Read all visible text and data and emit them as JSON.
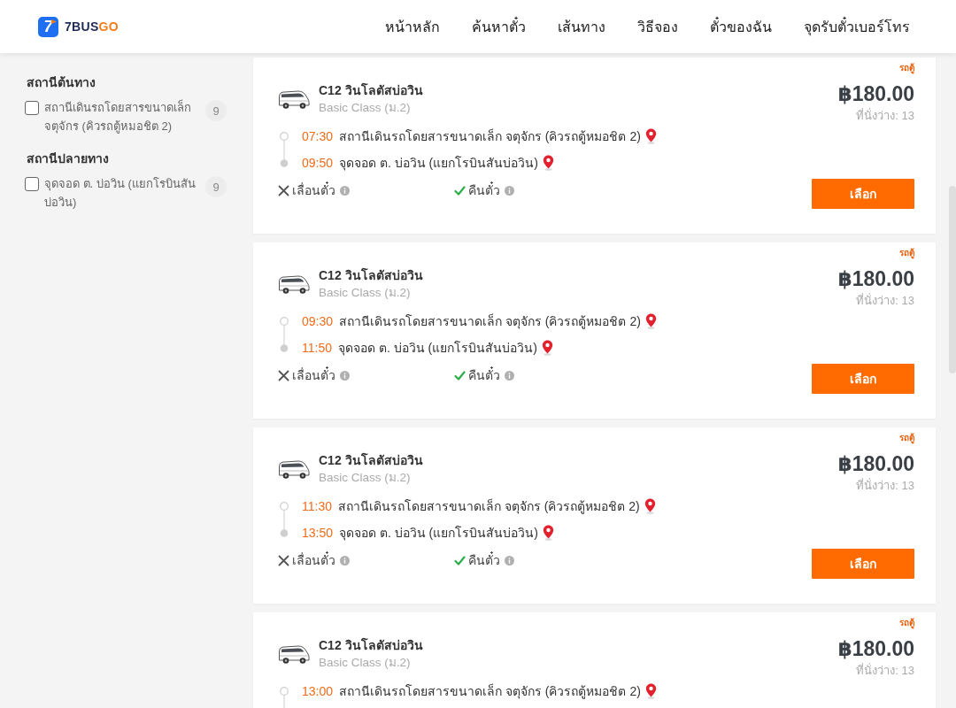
{
  "header": {
    "logo": {
      "mark": "7",
      "name_main": "7BUS",
      "name_accent": "GO"
    },
    "nav": [
      {
        "label": "หน้าหลัก"
      },
      {
        "label": "ค้นหาตั๋ว"
      },
      {
        "label": "เส้นทาง"
      },
      {
        "label": "วิธีจอง"
      },
      {
        "label": "ตั๋วของฉัน"
      },
      {
        "label": "จุดรับตั๋วเบอร์โทร"
      }
    ]
  },
  "filters": [
    {
      "title": "สถานีต้นทาง",
      "options": [
        {
          "label": "สถานีเดินรถโดยสารขนาดเล็ก จตุจักร (คิวรถตู้หมอชิต 2)",
          "count": "9",
          "checked": false
        }
      ]
    },
    {
      "title": "สถานีปลายทาง",
      "options": [
        {
          "label": "จุดจอด ต. บ่อวิน (แยกโรบินสันบ่อวิน)",
          "count": "9",
          "checked": false
        }
      ]
    }
  ],
  "trips": [
    {
      "vehicle_type": "รถตู้",
      "route": "C12 วินโลตัสบ่อวิน",
      "class": "Basic Class (ม.2)",
      "price": "฿180.00",
      "seats": "ที่นั่งว่าง: 13",
      "stops": [
        {
          "kind": "departure",
          "time": "07:30",
          "place": "สถานีเดินรถโดยสารขนาดเล็ก จตุจักร (คิวรถตู้หมอชิต 2)"
        },
        {
          "kind": "arrival",
          "time": "09:50",
          "place": "จุดจอด ต. บ่อวิน (แยกโรบินสันบ่อวิน)"
        }
      ],
      "features": [
        {
          "label": "เลื่อนตั๋ว",
          "available": false
        },
        {
          "label": "คืนตั๋ว",
          "available": true
        }
      ],
      "button": "เลือก"
    },
    {
      "vehicle_type": "รถตู้",
      "route": "C12 วินโลตัสบ่อวิน",
      "class": "Basic Class (ม.2)",
      "price": "฿180.00",
      "seats": "ที่นั่งว่าง: 13",
      "stops": [
        {
          "kind": "departure",
          "time": "09:30",
          "place": "สถานีเดินรถโดยสารขนาดเล็ก จตุจักร (คิวรถตู้หมอชิต 2)"
        },
        {
          "kind": "arrival",
          "time": "11:50",
          "place": "จุดจอด ต. บ่อวิน (แยกโรบินสันบ่อวิน)"
        }
      ],
      "features": [
        {
          "label": "เลื่อนตั๋ว",
          "available": false
        },
        {
          "label": "คืนตั๋ว",
          "available": true
        }
      ],
      "button": "เลือก"
    },
    {
      "vehicle_type": "รถตู้",
      "route": "C12 วินโลตัสบ่อวิน",
      "class": "Basic Class (ม.2)",
      "price": "฿180.00",
      "seats": "ที่นั่งว่าง: 13",
      "stops": [
        {
          "kind": "departure",
          "time": "11:30",
          "place": "สถานีเดินรถโดยสารขนาดเล็ก จตุจักร (คิวรถตู้หมอชิต 2)"
        },
        {
          "kind": "arrival",
          "time": "13:50",
          "place": "จุดจอด ต. บ่อวิน (แยกโรบินสันบ่อวิน)"
        }
      ],
      "features": [
        {
          "label": "เลื่อนตั๋ว",
          "available": false
        },
        {
          "label": "คืนตั๋ว",
          "available": true
        }
      ],
      "button": "เลือก"
    },
    {
      "vehicle_type": "รถตู้",
      "route": "C12 วินโลตัสบ่อวิน",
      "class": "Basic Class (ม.2)",
      "price": "฿180.00",
      "seats": "ที่นั่งว่าง: 13",
      "stops": [
        {
          "kind": "departure",
          "time": "13:00",
          "place": "สถานีเดินรถโดยสารขนาดเล็ก จตุจักร (คิวรถตู้หมอชิต 2)"
        }
      ]
    }
  ]
}
